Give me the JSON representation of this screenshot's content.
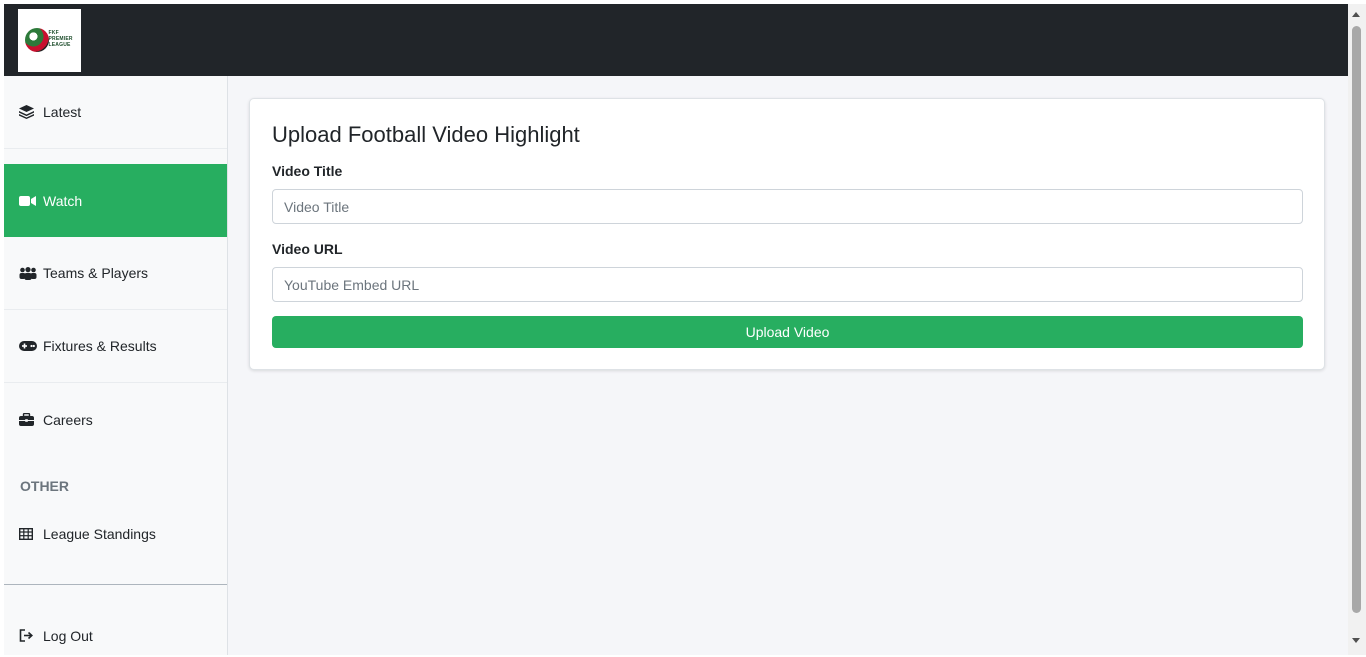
{
  "brand": {
    "logo_text": "FKF PREMIER LEAGUE"
  },
  "sidebar": {
    "items": [
      {
        "label": "Latest",
        "icon": "layers-icon"
      },
      {
        "label": "Watch",
        "icon": "video-camera-icon",
        "active": true
      },
      {
        "label": "Teams & Players",
        "icon": "users-icon"
      },
      {
        "label": "Fixtures & Results",
        "icon": "gamepad-icon"
      },
      {
        "label": "Careers",
        "icon": "briefcase-icon"
      }
    ],
    "section_other": "OTHER",
    "other_items": [
      {
        "label": "League Standings",
        "icon": "table-grid-icon"
      }
    ],
    "logout_label": "Log Out"
  },
  "form": {
    "title": "Upload Football Video Highlight",
    "title_label": "Video Title",
    "title_placeholder": "Video Title",
    "title_value": "",
    "url_label": "Video URL",
    "url_placeholder": "YouTube Embed URL",
    "url_value": "",
    "submit_label": "Upload Video"
  },
  "colors": {
    "accent": "#27ae60",
    "topbar": "#212529",
    "sidebar_bg": "#f8f9fa",
    "page_bg": "#f5f6f9"
  }
}
